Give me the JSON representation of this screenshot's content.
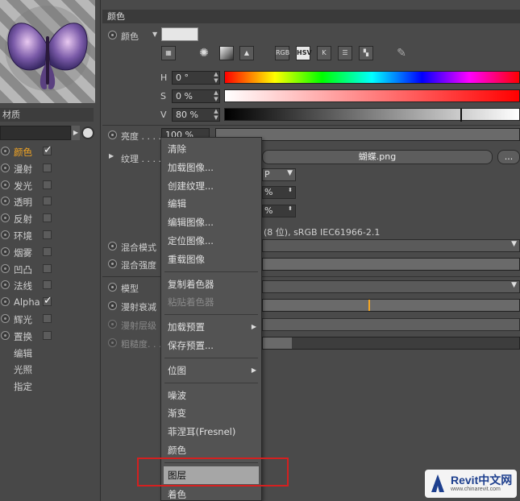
{
  "left": {
    "material_label": "材质",
    "channels": [
      {
        "label": "颜色",
        "checked": true,
        "active": true
      },
      {
        "label": "漫射",
        "checked": false
      },
      {
        "label": "发光",
        "checked": false
      },
      {
        "label": "透明",
        "checked": false
      },
      {
        "label": "反射",
        "checked": false
      },
      {
        "label": "环境",
        "checked": false
      },
      {
        "label": "烟雾",
        "checked": false
      },
      {
        "label": "凹凸",
        "checked": false
      },
      {
        "label": "法线",
        "checked": false
      },
      {
        "label": "Alpha",
        "checked": true
      },
      {
        "label": "辉光",
        "checked": false
      },
      {
        "label": "置换",
        "checked": false
      }
    ],
    "extra_items": [
      "编辑",
      "光照",
      "指定"
    ]
  },
  "panel": {
    "section_title": "颜色",
    "color_label": "颜色",
    "tool_icons": [
      {
        "name": "picker-icon",
        "glyph": "▦"
      },
      {
        "name": "color-wheel-icon",
        "glyph": "✺"
      },
      {
        "name": "spectrum-icon",
        "glyph": "■"
      },
      {
        "name": "image-icon",
        "glyph": "▲"
      },
      {
        "name": "rgb-mode",
        "glyph": "RGB"
      },
      {
        "name": "hsv-mode",
        "glyph": "HSV",
        "selected": true
      },
      {
        "name": "kelvin-mode",
        "glyph": "K"
      },
      {
        "name": "mixer-icon",
        "glyph": "☰"
      },
      {
        "name": "swatches-icon",
        "glyph": "▚"
      },
      {
        "name": "eyedropper-icon",
        "glyph": "✎"
      }
    ],
    "h": {
      "label": "H",
      "value": "0 °"
    },
    "s": {
      "label": "S",
      "value": "0 %"
    },
    "v": {
      "label": "V",
      "value": "80 %",
      "level": 0.8
    },
    "brightness": {
      "label": "亮度 . . . .",
      "value": "100 %"
    },
    "texture_label": "纹理 . . . . .",
    "texture_file": "蝴蝶.png",
    "texture_more": "...",
    "texture_partial_1": "P",
    "texture_partial_2": "%",
    "texture_partial_3": "%",
    "texture_info": "(8 位), sRGB IEC61966-2.1",
    "mix_mode_label": "混合模式",
    "mix_strength_label": "混合强度",
    "model_label": "模型",
    "diffuse_falloff_label": "漫射衰减",
    "diffuse_level_label": "漫射层级",
    "roughness_label": "粗糙度. . ."
  },
  "menu": {
    "groups": [
      [
        "清除",
        "加载图像...",
        "创建纹理...",
        "编辑",
        "编辑图像...",
        "定位图像...",
        "重载图像"
      ],
      [
        "复制着色器",
        "粘贴着色器"
      ],
      [
        "加载预置",
        "保存预置..."
      ],
      [
        "位图"
      ],
      [
        "噪波",
        "渐变",
        "菲涅耳(Fresnel)",
        "颜色"
      ],
      [
        "图层",
        "着色"
      ]
    ],
    "disabled": [
      "粘贴着色器"
    ],
    "submenus": [
      "加载预置",
      "位图"
    ],
    "highlighted": "图层"
  },
  "watermark": {
    "title": "Revit中文网",
    "sub": "www.chinarevit.com"
  },
  "colors": {
    "accent": "#f5a623",
    "highlight_box": "#d42020"
  }
}
